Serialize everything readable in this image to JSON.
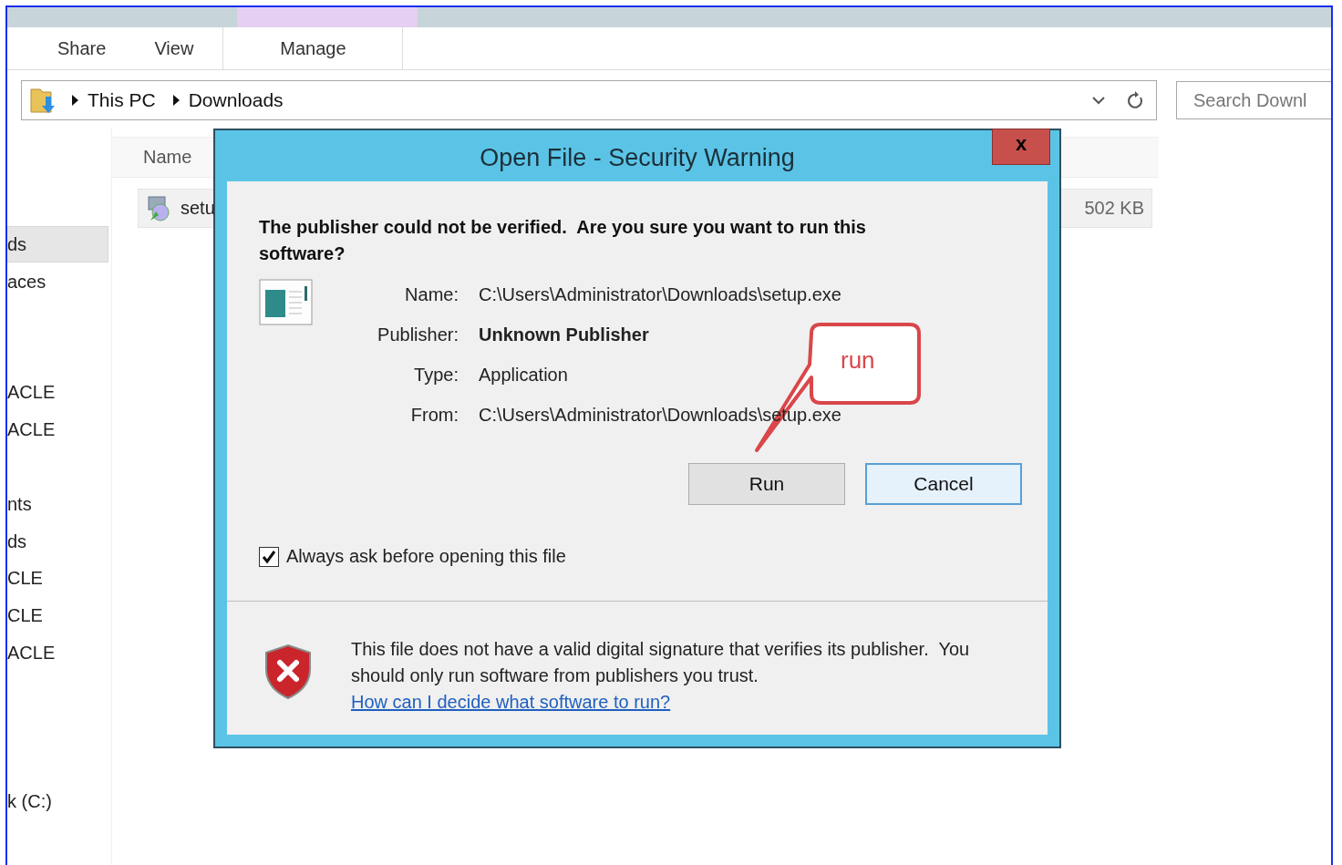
{
  "ribbon": {
    "tabs": [
      {
        "label": "Share",
        "selected": false,
        "kind": "plain"
      },
      {
        "label": "View",
        "selected": false,
        "kind": "plain"
      },
      {
        "label": "Manage",
        "selected": false,
        "kind": "contextual"
      }
    ]
  },
  "address": {
    "crumbs": [
      "This PC",
      "Downloads"
    ]
  },
  "search": {
    "placeholder": "Search Downl"
  },
  "sidebar": {
    "items": [
      {
        "label": "ds",
        "selected": true
      },
      {
        "label": "aces",
        "selected": false
      },
      {
        "label": "ACLE",
        "selected": false
      },
      {
        "label": "ACLE",
        "selected": false
      },
      {
        "label": "nts",
        "selected": false
      },
      {
        "label": "ds",
        "selected": false
      },
      {
        "label": "CLE",
        "selected": false
      },
      {
        "label": "CLE",
        "selected": false
      },
      {
        "label": "ACLE",
        "selected": false
      },
      {
        "label": "k (C:)",
        "selected": false
      }
    ]
  },
  "file_list": {
    "columns": [
      "Name"
    ],
    "rows": [
      {
        "name": "setu",
        "size": "502 KB"
      }
    ]
  },
  "dialog": {
    "title": "Open File - Security Warning",
    "close": "x",
    "question": "The publisher could not be verified.  Are you sure you want to run this software?",
    "fields": [
      {
        "label": "Name:",
        "value": "C:\\Users\\Administrator\\Downloads\\setup.exe",
        "kind": "plain"
      },
      {
        "label": "Publisher:",
        "value": "Unknown Publisher",
        "kind": "bold"
      },
      {
        "label": "Type:",
        "value": "Application",
        "kind": "plain"
      },
      {
        "label": "From:",
        "value": "C:\\Users\\Administrator\\Downloads\\setup.exe",
        "kind": "plain"
      }
    ],
    "buttons": [
      {
        "label": "Run",
        "kind": "normal"
      },
      {
        "label": "Cancel",
        "kind": "focused"
      }
    ],
    "always_ask": {
      "label": "Always ask before opening this file",
      "checked": true
    },
    "notice": "This file does not have a valid digital signature that verifies its publisher.  You should only run software from publishers you trust.",
    "help_link": "How can I decide what software to run?"
  },
  "callout": {
    "text": "run"
  }
}
